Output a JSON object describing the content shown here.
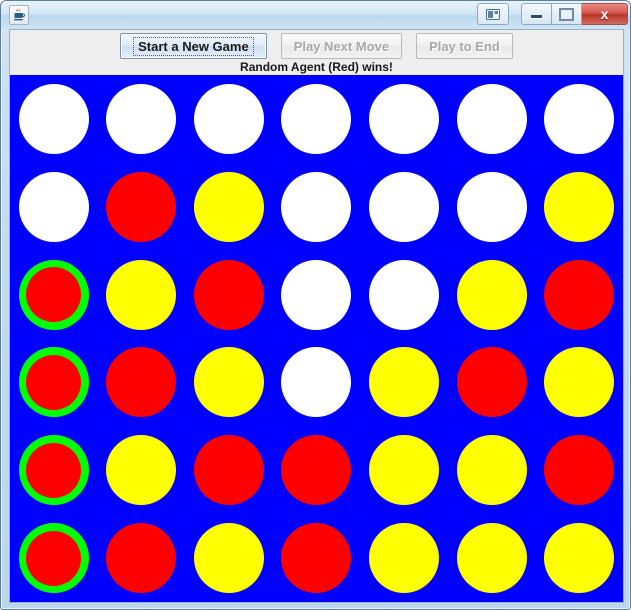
{
  "window": {
    "title": "",
    "app_icon": "java-coffee-cup-icon",
    "controls": {
      "aux_label": "restore-layout-icon",
      "minimize_label": "minimize-icon",
      "maximize_label": "maximize-icon",
      "close_label": "x"
    }
  },
  "toolbar": {
    "buttons": [
      {
        "label": "Start a New Game",
        "state": "focused"
      },
      {
        "label": "Play Next Move",
        "state": "disabled"
      },
      {
        "label": "Play to End",
        "state": "disabled"
      }
    ]
  },
  "status": {
    "message": "Random Agent (Red) wins!"
  },
  "board": {
    "rows": 6,
    "cols": 7,
    "colors": {
      "background": "#0000ff",
      "empty": "#ffffff",
      "red": "#ff0000",
      "yellow": "#ffff00",
      "winner_ring": "#00ff00"
    },
    "legend": {
      "empty": "empty",
      "red": "red",
      "yellow": "yellow"
    },
    "cells": [
      [
        "empty",
        "empty",
        "empty",
        "empty",
        "empty",
        "empty",
        "empty"
      ],
      [
        "empty",
        "red",
        "yellow",
        "empty",
        "empty",
        "empty",
        "yellow"
      ],
      [
        "red",
        "yellow",
        "red",
        "empty",
        "empty",
        "yellow",
        "red"
      ],
      [
        "red",
        "red",
        "yellow",
        "empty",
        "yellow",
        "red",
        "yellow"
      ],
      [
        "red",
        "yellow",
        "red",
        "red",
        "yellow",
        "yellow",
        "red"
      ],
      [
        "red",
        "red",
        "yellow",
        "red",
        "yellow",
        "yellow",
        "yellow"
      ]
    ],
    "winning_cells": [
      [
        2,
        0
      ],
      [
        3,
        0
      ],
      [
        4,
        0
      ],
      [
        5,
        0
      ]
    ]
  }
}
